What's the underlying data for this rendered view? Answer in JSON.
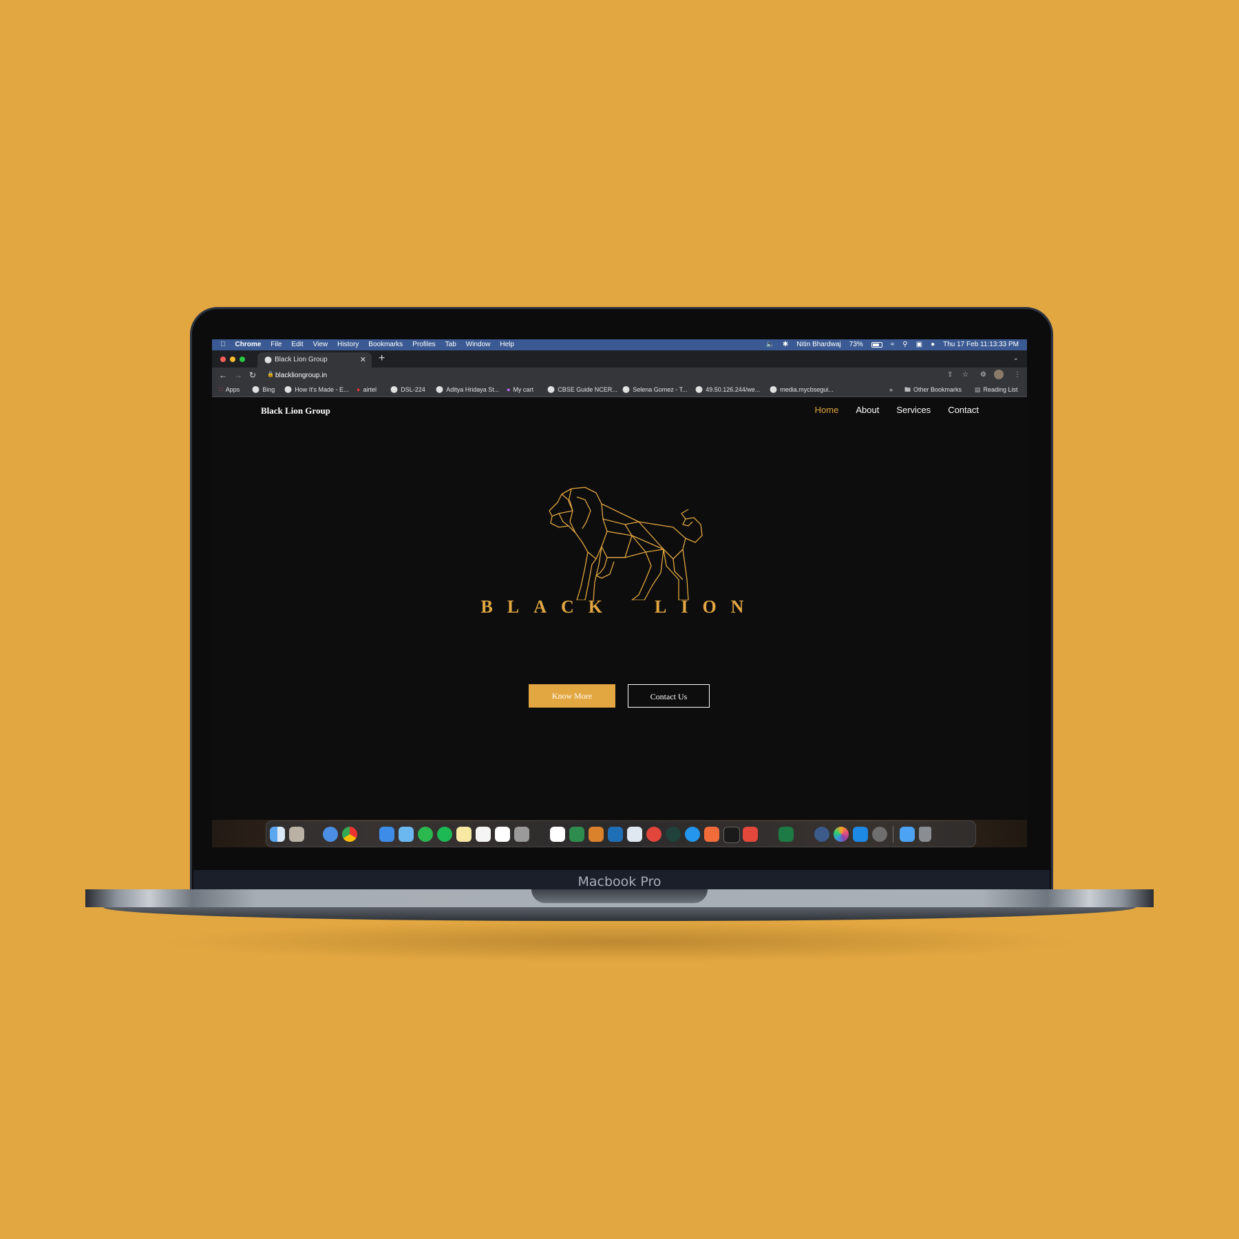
{
  "device": {
    "label": "Macbook Pro"
  },
  "mac_menubar": {
    "app": "Chrome",
    "items": [
      "File",
      "Edit",
      "View",
      "History",
      "Bookmarks",
      "Profiles",
      "Tab",
      "Window",
      "Help"
    ],
    "user": "Nitin Bhardwaj",
    "battery": "73%",
    "datetime": "Thu 17 Feb  11:13:33 PM"
  },
  "browser": {
    "tab_title": "Black Lion Group",
    "url": "blackliongroup.in",
    "bookmarks": [
      "Apps",
      "Bing",
      "How It's Made - E...",
      "airtel",
      "DSL-224",
      "Aditya Hridaya St...",
      "My cart",
      "CBSE Guide NCER...",
      "Selena Gomez - T...",
      "49.50.126.244/we...",
      "media.mycbsegui..."
    ],
    "overflow": "»",
    "other_bookmarks": "Other Bookmarks",
    "reading_list": "Reading List"
  },
  "site": {
    "brand": "Black Lion Group",
    "nav": [
      "Home",
      "About",
      "Services",
      "Contact"
    ],
    "active_nav": "Home",
    "wordmark": "BLACK  LION",
    "buttons": {
      "primary": "Know More",
      "secondary": "Contact Us"
    },
    "accent_color": "#e2a741"
  },
  "icons": [
    "apple-icon",
    "volume-icon",
    "bluetooth-icon",
    "wifi-icon",
    "search-icon",
    "control-center-icon",
    "globe-icon",
    "close-icon",
    "plus-icon",
    "back-icon",
    "forward-icon",
    "reload-icon",
    "lock-icon",
    "share-icon",
    "star-icon",
    "extensions-icon",
    "profile-icon",
    "more-icon",
    "folder-icon",
    "lion-logo-icon"
  ]
}
